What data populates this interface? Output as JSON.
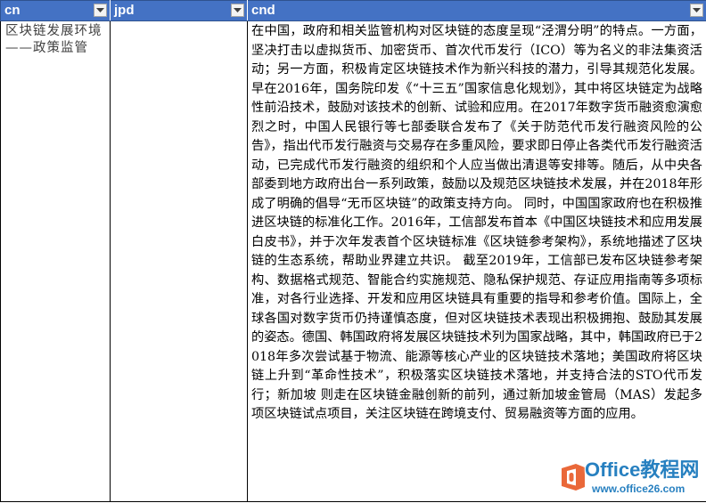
{
  "columns": [
    {
      "header": "cn",
      "filter_icon": "dropdown-arrow-icon"
    },
    {
      "header": "jpd",
      "filter_icon": "dropdown-arrow-icon"
    },
    {
      "header": "cnd",
      "filter_icon": "dropdown-arrow-icon"
    }
  ],
  "rows": [
    {
      "cn": "区块链发展环境——政策监管",
      "jpd": "",
      "cnd": "在中国，政府和相关监管机构对区块链的态度呈现“泾渭分明”的特点。一方面，坚决打击以虚拟货币、加密货币、首次代币发行（ICO）等为名义的非法集资活动；另一方面，积极肯定区块链技术作为新兴科技的潜力，引导其规范化发展。早在2016年，国务院印发《“十三五”国家信息化规划》，其中将区块链定为战略性前沿技术，鼓励对该技术的创新、试验和应用。在2017年数字货币融资愈演愈烈之时，中国人民银行等七部委联合发布了《关于防范代币发行融资风险的公告》，指出代币发行融资与交易存在多重风险，要求即日停止各类代币发行融资活动，已完成代币发行融资的组织和个人应当做出清退等安排等。随后，从中央各部委到地方政府出台一系列政策，鼓励以及规范区块链技术发展，并在2018年形成了明确的倡导“无币区块链”的政策支持方向。 同时，中国国家政府也在积极推进区块链的标准化工作。2016年，工信部发布首本《中国区块链技术和应用发展白皮书》，并于次年发表首个区块链标准《区块链参考架构》，系统地描述了区块链的生态系统，帮助业界建立共识。 截至2019年，工信部已发布区块链参考架构、数据格式规范、智能合约实施规范、隐私保护规范、存证应用指南等多项标准，对各行业选择、开发和应用区块链具有重要的指导和参考价值。国际上，全球各国对数字货币仍持谨慎态度，但对区块链技术表现出积极拥抱、鼓励其发展的姿态。德国、韩国政府将发展区块链技术列为国家战略，其中，韩国政府已于2018年多次尝试基于物流、能源等核心产业的区块链技术落地；美国政府将区块链上升到“革命性技术”，积极落实区块链技术落地，并支持合法的STO代币发行；新加坡 则走在区块链金融创新的前列，通过新加坡金管局（MAS）发起多项区块链试点项目，关注区块链在跨境支付、贸易融资等方面的应用。"
    }
  ],
  "watermark": {
    "logo_icon": "office-logo-icon",
    "title": "Office教程网",
    "url": "www.office26.com"
  },
  "colors": {
    "header_bg": "#4472c4",
    "header_text": "#ffffff",
    "grid_border": "#000000",
    "watermark": "#0a6fb8"
  }
}
